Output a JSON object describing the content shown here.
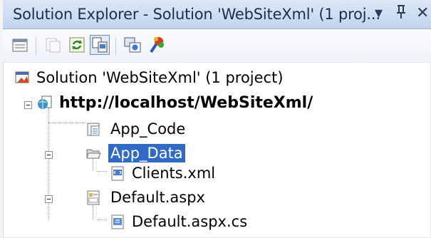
{
  "window": {
    "title": "Solution Explorer - Solution 'WebSiteXml' (1 proj...",
    "controls": {
      "dropdown": "▾",
      "pin": "Ꝕ",
      "close": "✕"
    }
  },
  "toolbar": {
    "buttons": [
      {
        "name": "properties-icon",
        "state": "normal"
      },
      {
        "name": "show-all-files-icon",
        "state": "disabled"
      },
      {
        "name": "refresh-icon",
        "state": "normal"
      },
      {
        "name": "nest-related-files-icon",
        "state": "pressed"
      },
      {
        "name": "copy-website-icon",
        "state": "normal"
      },
      {
        "name": "asp-net-configuration-icon",
        "state": "normal"
      }
    ]
  },
  "tree": {
    "solution": "Solution 'WebSiteXml' (1 project)",
    "project": "http://localhost/WebSiteXml/",
    "app_code": "App_Code",
    "app_data": "App_Data",
    "clients": "Clients.xml",
    "default": "Default.aspx",
    "default_cs": "Default.aspx.cs"
  },
  "colors": {
    "selection": "#316ac5",
    "titlebar": "#c3d4ee"
  }
}
